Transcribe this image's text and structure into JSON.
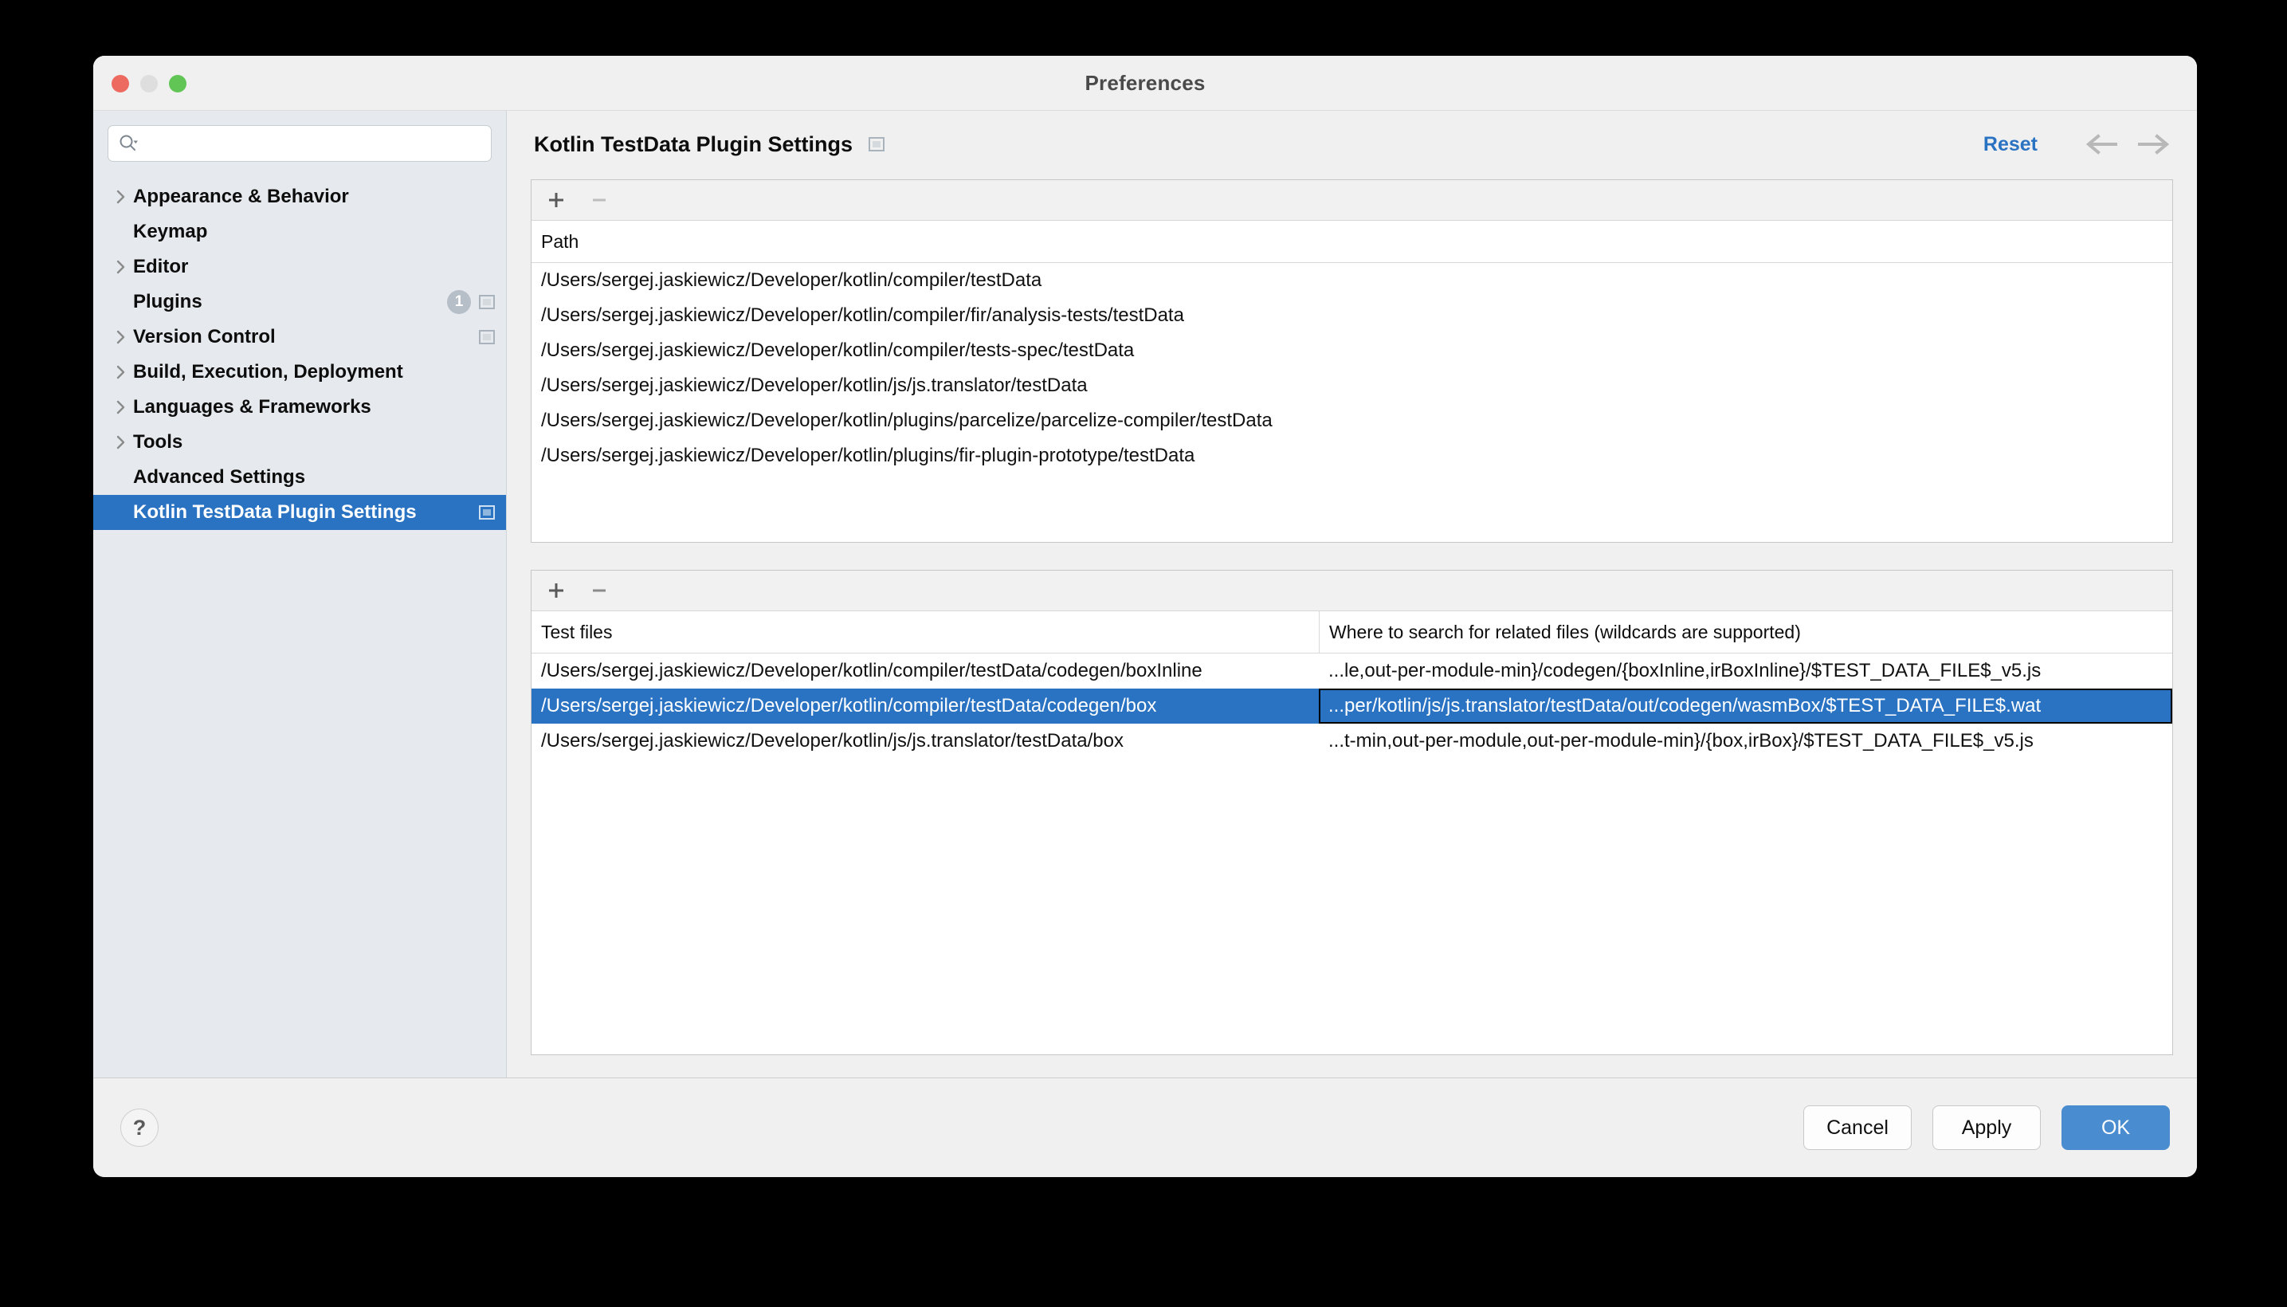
{
  "window": {
    "title": "Preferences",
    "traffic_lights": [
      "close",
      "minimize",
      "zoom"
    ]
  },
  "sidebar": {
    "search": {
      "value": "",
      "placeholder": ""
    },
    "items": [
      {
        "label": "Appearance & Behavior",
        "expandable": true,
        "selected": false,
        "badge": null,
        "panel_icon": false
      },
      {
        "label": "Keymap",
        "expandable": false,
        "selected": false,
        "badge": null,
        "panel_icon": false
      },
      {
        "label": "Editor",
        "expandable": true,
        "selected": false,
        "badge": null,
        "panel_icon": false
      },
      {
        "label": "Plugins",
        "expandable": false,
        "selected": false,
        "badge": "1",
        "panel_icon": true
      },
      {
        "label": "Version Control",
        "expandable": true,
        "selected": false,
        "badge": null,
        "panel_icon": true
      },
      {
        "label": "Build, Execution, Deployment",
        "expandable": true,
        "selected": false,
        "badge": null,
        "panel_icon": false
      },
      {
        "label": "Languages & Frameworks",
        "expandable": true,
        "selected": false,
        "badge": null,
        "panel_icon": false
      },
      {
        "label": "Tools",
        "expandable": true,
        "selected": false,
        "badge": null,
        "panel_icon": false
      },
      {
        "label": "Advanced Settings",
        "expandable": false,
        "selected": false,
        "badge": null,
        "panel_icon": false
      },
      {
        "label": "Kotlin TestData Plugin Settings",
        "expandable": false,
        "selected": true,
        "badge": null,
        "panel_icon": true
      }
    ]
  },
  "main": {
    "page_title": "Kotlin TestData Plugin Settings",
    "reset_label": "Reset",
    "nav_back_icon": "arrow-left-icon",
    "nav_forward_icon": "arrow-right-icon",
    "paths_panel": {
      "add_label": "+",
      "remove_label": "−",
      "columns": [
        "Path"
      ],
      "rows": [
        "/Users/sergej.jaskiewicz/Developer/kotlin/compiler/testData",
        "/Users/sergej.jaskiewicz/Developer/kotlin/compiler/fir/analysis-tests/testData",
        "/Users/sergej.jaskiewicz/Developer/kotlin/compiler/tests-spec/testData",
        "/Users/sergej.jaskiewicz/Developer/kotlin/js/js.translator/testData",
        "/Users/sergej.jaskiewicz/Developer/kotlin/plugins/parcelize/parcelize-compiler/testData",
        "/Users/sergej.jaskiewicz/Developer/kotlin/plugins/fir-plugin-prototype/testData"
      ]
    },
    "tests_panel": {
      "add_label": "+",
      "remove_label": "−",
      "columns": [
        "Test files",
        "Where to search for related files (wildcards are supported)"
      ],
      "rows": [
        {
          "test_files": "/Users/sergej.jaskiewicz/Developer/kotlin/compiler/testData/codegen/boxInline",
          "search_pattern": "...le,out-per-module-min}/codegen/{boxInline,irBoxInline}/$TEST_DATA_FILE$_v5.js",
          "selected": false,
          "focused_cell": null
        },
        {
          "test_files": "/Users/sergej.jaskiewicz/Developer/kotlin/compiler/testData/codegen/box",
          "search_pattern": "...per/kotlin/js/js.translator/testData/out/codegen/wasmBox/$TEST_DATA_FILE$.wat",
          "selected": true,
          "focused_cell": "search_pattern"
        },
        {
          "test_files": "/Users/sergej.jaskiewicz/Developer/kotlin/js/js.translator/testData/box",
          "search_pattern": "...t-min,out-per-module,out-per-module-min}/{box,irBox}/$TEST_DATA_FILE$_v5.js",
          "selected": false,
          "focused_cell": null
        }
      ]
    }
  },
  "footer": {
    "help_label": "?",
    "cancel_label": "Cancel",
    "apply_label": "Apply",
    "ok_label": "OK"
  },
  "colors": {
    "selection_blue": "#2a72c2",
    "link_blue": "#2a72c2",
    "primary_button": "#4a8cd0",
    "sidebar_bg": "#e6eaee",
    "window_bg": "#f0f0f0",
    "badge_gray": "#b6bfc8"
  }
}
